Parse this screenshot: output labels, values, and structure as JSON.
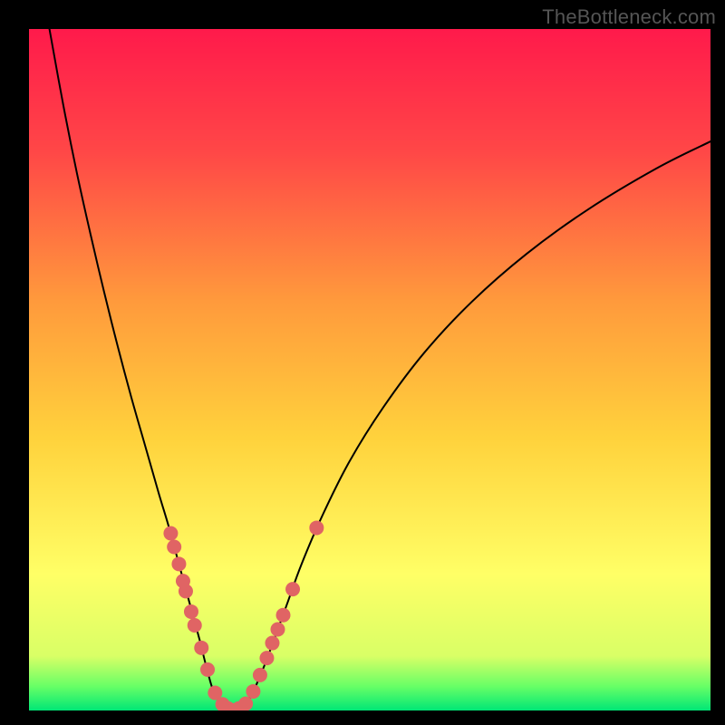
{
  "watermark": "TheBottleneck.com",
  "chart_data": {
    "type": "line",
    "title": "",
    "xlabel": "",
    "ylabel": "",
    "xlim": [
      0,
      100
    ],
    "ylim": [
      0,
      100
    ],
    "grid": false,
    "legend": false,
    "background_gradient": {
      "stops": [
        {
          "offset": 0.0,
          "color": "#ff1a4b"
        },
        {
          "offset": 0.18,
          "color": "#ff4747"
        },
        {
          "offset": 0.4,
          "color": "#ff9a3c"
        },
        {
          "offset": 0.6,
          "color": "#ffd23c"
        },
        {
          "offset": 0.8,
          "color": "#ffff66"
        },
        {
          "offset": 0.92,
          "color": "#d9ff66"
        },
        {
          "offset": 0.965,
          "color": "#66ff66"
        },
        {
          "offset": 1.0,
          "color": "#00e676"
        }
      ]
    },
    "series": [
      {
        "name": "left-curve",
        "type": "line",
        "color": "#000000",
        "width": 2.0,
        "points": [
          {
            "x": 3.0,
            "y": 100.0
          },
          {
            "x": 5.0,
            "y": 89.0
          },
          {
            "x": 7.0,
            "y": 79.0
          },
          {
            "x": 9.0,
            "y": 70.0
          },
          {
            "x": 11.0,
            "y": 61.5
          },
          {
            "x": 13.0,
            "y": 53.5
          },
          {
            "x": 15.0,
            "y": 46.0
          },
          {
            "x": 17.0,
            "y": 39.0
          },
          {
            "x": 19.0,
            "y": 32.0
          },
          {
            "x": 20.5,
            "y": 27.0
          },
          {
            "x": 22.0,
            "y": 21.5
          },
          {
            "x": 23.5,
            "y": 16.0
          },
          {
            "x": 25.0,
            "y": 10.5
          },
          {
            "x": 26.0,
            "y": 6.5
          },
          {
            "x": 27.0,
            "y": 3.0
          },
          {
            "x": 28.0,
            "y": 1.2
          },
          {
            "x": 29.0,
            "y": 0.4
          },
          {
            "x": 30.0,
            "y": 0.0
          }
        ]
      },
      {
        "name": "right-curve",
        "type": "line",
        "color": "#000000",
        "width": 2.0,
        "points": [
          {
            "x": 30.0,
            "y": 0.0
          },
          {
            "x": 31.0,
            "y": 0.4
          },
          {
            "x": 32.0,
            "y": 1.2
          },
          {
            "x": 33.0,
            "y": 3.0
          },
          {
            "x": 34.5,
            "y": 6.5
          },
          {
            "x": 36.0,
            "y": 10.5
          },
          {
            "x": 38.0,
            "y": 16.0
          },
          {
            "x": 40.0,
            "y": 21.5
          },
          {
            "x": 43.0,
            "y": 28.5
          },
          {
            "x": 47.0,
            "y": 36.5
          },
          {
            "x": 52.0,
            "y": 44.5
          },
          {
            "x": 58.0,
            "y": 52.5
          },
          {
            "x": 65.0,
            "y": 60.0
          },
          {
            "x": 73.0,
            "y": 67.0
          },
          {
            "x": 82.0,
            "y": 73.5
          },
          {
            "x": 92.0,
            "y": 79.5
          },
          {
            "x": 100.0,
            "y": 83.5
          }
        ]
      },
      {
        "name": "dots-left",
        "type": "scatter",
        "color": "#e06464",
        "radius": 8,
        "points": [
          {
            "x": 20.8,
            "y": 26.0
          },
          {
            "x": 21.3,
            "y": 24.0
          },
          {
            "x": 22.0,
            "y": 21.5
          },
          {
            "x": 22.6,
            "y": 19.0
          },
          {
            "x": 23.0,
            "y": 17.5
          },
          {
            "x": 23.8,
            "y": 14.5
          },
          {
            "x": 24.3,
            "y": 12.5
          },
          {
            "x": 25.3,
            "y": 9.2
          },
          {
            "x": 26.2,
            "y": 6.0
          },
          {
            "x": 27.3,
            "y": 2.6
          },
          {
            "x": 28.4,
            "y": 0.9
          },
          {
            "x": 29.2,
            "y": 0.3
          },
          {
            "x": 30.0,
            "y": 0.0
          }
        ]
      },
      {
        "name": "dots-right",
        "type": "scatter",
        "color": "#e06464",
        "radius": 8,
        "points": [
          {
            "x": 30.8,
            "y": 0.3
          },
          {
            "x": 31.8,
            "y": 1.0
          },
          {
            "x": 32.9,
            "y": 2.8
          },
          {
            "x": 33.9,
            "y": 5.2
          },
          {
            "x": 34.9,
            "y": 7.7
          },
          {
            "x": 35.7,
            "y": 9.9
          },
          {
            "x": 36.5,
            "y": 11.9
          },
          {
            "x": 37.3,
            "y": 14.0
          },
          {
            "x": 38.7,
            "y": 17.8
          },
          {
            "x": 42.2,
            "y": 26.8
          }
        ]
      }
    ]
  }
}
